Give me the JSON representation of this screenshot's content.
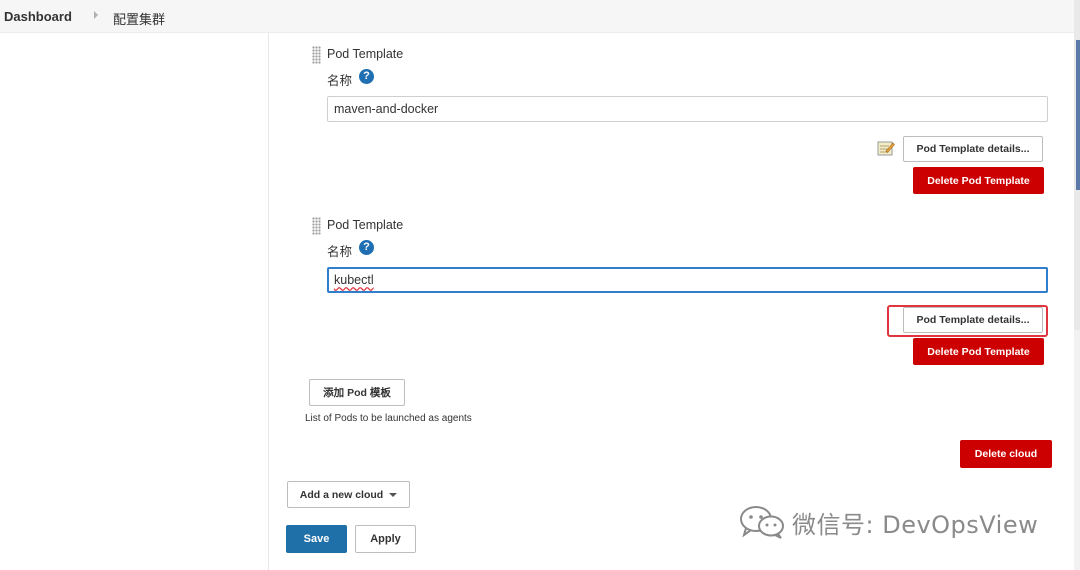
{
  "breadcrumb": {
    "root": "Dashboard",
    "current": "配置集群"
  },
  "pod_templates": [
    {
      "title": "Pod Template",
      "name_label": "名称",
      "help": "?",
      "name_value": "maven-and-docker",
      "details_button": "Pod Template details...",
      "delete_button": "Delete Pod Template"
    },
    {
      "title": "Pod Template",
      "name_label": "名称",
      "help": "?",
      "name_value": "kubectl",
      "details_button": "Pod Template details...",
      "delete_button": "Delete Pod Template"
    }
  ],
  "add_pod_template_button": "添加 Pod 模板",
  "pods_helper_text": "List of Pods to be launched as agents",
  "delete_cloud_button": "Delete cloud",
  "add_cloud_button": "Add a new cloud",
  "save_button": "Save",
  "apply_button": "Apply",
  "watermark": "微信号: DevOpsView",
  "colors": {
    "danger": "#cc0000",
    "primary": "#1f6fa8",
    "focus": "#2f7fcc",
    "highlight": "#e0353f"
  },
  "icons": [
    "drag-handle-icon",
    "help-icon",
    "notepad-icon",
    "chevron-down-icon",
    "wechat-icon"
  ]
}
